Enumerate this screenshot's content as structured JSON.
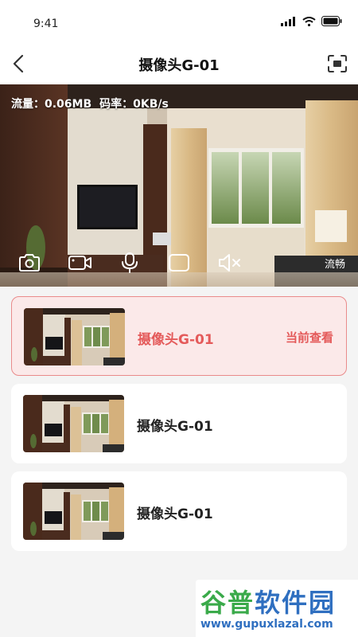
{
  "status_bar": {
    "time": "9:41"
  },
  "nav": {
    "title": "摄像头G-01"
  },
  "video": {
    "traffic_label": "流量：0.06MB",
    "bitrate_label": "码率：0KB/s",
    "quality_label": "流畅"
  },
  "cameras": [
    {
      "name": "摄像头G-01",
      "status": "当前查看",
      "active": true
    },
    {
      "name": "摄像头G-01",
      "status": "",
      "active": false
    },
    {
      "name": "摄像头G-01",
      "status": "",
      "active": false
    }
  ],
  "watermark": {
    "brand_a": "谷普",
    "brand_b": "软件园",
    "url": "www.gupuxlazal.com"
  },
  "colors": {
    "accent": "#e45a5a",
    "accent_bg": "#fbe9e9",
    "page_bg": "#f4f4f4"
  },
  "icons": [
    "back-arrow-icon",
    "fullscreen-icon",
    "camera-icon",
    "video-record-icon",
    "microphone-icon",
    "screen-icon",
    "mute-icon"
  ]
}
